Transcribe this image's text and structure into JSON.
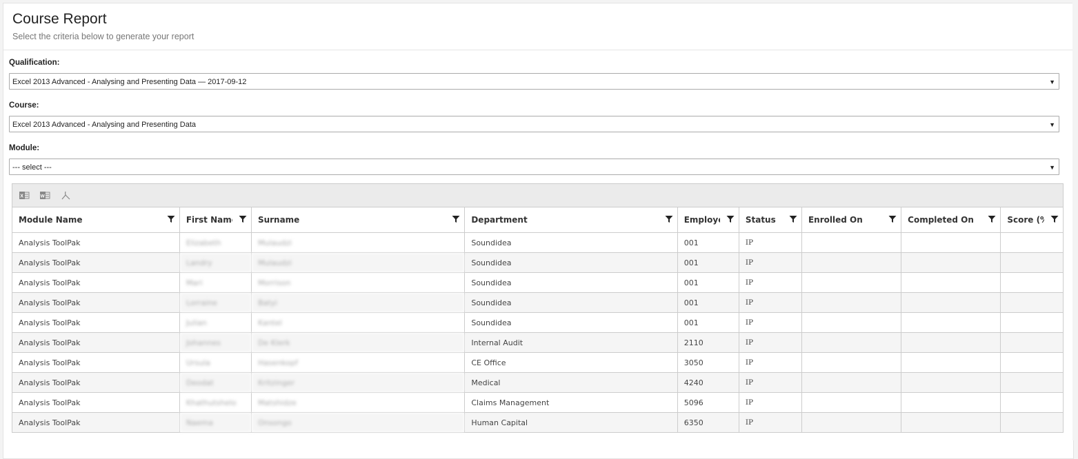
{
  "header": {
    "title": "Course Report",
    "subtitle": "Select the criteria below to generate your report"
  },
  "form": {
    "qualification": {
      "label": "Qualification:",
      "value": "Excel 2013 Advanced - Analysing and Presenting Data — 2017-09-12"
    },
    "course": {
      "label": "Course:",
      "value": "Excel 2013 Advanced - Analysing and Presenting Data"
    },
    "module": {
      "label": "Module:",
      "value": "--- select ---"
    },
    "caret_glyph": "▼"
  },
  "toolbar": {
    "icons": [
      "excel-export-icon",
      "word-export-icon",
      "pdf-export-icon"
    ]
  },
  "table": {
    "columns": [
      {
        "label": "Module Name"
      },
      {
        "label": "First Name"
      },
      {
        "label": "Surname"
      },
      {
        "label": "Department"
      },
      {
        "label": "Employee No"
      },
      {
        "label": "Status"
      },
      {
        "label": "Enrolled On"
      },
      {
        "label": "Completed On"
      },
      {
        "label": "Score (%)"
      }
    ],
    "rows": [
      {
        "module": "Analysis ToolPak",
        "first": "Elizabeth",
        "surname": "Mulaudzi",
        "department": "Soundidea",
        "employee": "001",
        "status": "IP",
        "enrolled": "",
        "completed": "",
        "score": ""
      },
      {
        "module": "Analysis ToolPak",
        "first": "Landry",
        "surname": "Mulaudzi",
        "department": "Soundidea",
        "employee": "001",
        "status": "IP",
        "enrolled": "",
        "completed": "",
        "score": ""
      },
      {
        "module": "Analysis ToolPak",
        "first": "Mari",
        "surname": "Morrison",
        "department": "Soundidea",
        "employee": "001",
        "status": "IP",
        "enrolled": "",
        "completed": "",
        "score": ""
      },
      {
        "module": "Analysis ToolPak",
        "first": "Lorraine",
        "surname": "Batyi",
        "department": "Soundidea",
        "employee": "001",
        "status": "IP",
        "enrolled": "",
        "completed": "",
        "score": ""
      },
      {
        "module": "Analysis ToolPak",
        "first": "Julian",
        "surname": "Kantel",
        "department": "Soundidea",
        "employee": "001",
        "status": "IP",
        "enrolled": "",
        "completed": "",
        "score": ""
      },
      {
        "module": "Analysis ToolPak",
        "first": "Johannes",
        "surname": "De Klerk",
        "department": "Internal Audit",
        "employee": "2110",
        "status": "IP",
        "enrolled": "",
        "completed": "",
        "score": ""
      },
      {
        "module": "Analysis ToolPak",
        "first": "Ursula",
        "surname": "Hasenkopf",
        "department": "CE Office",
        "employee": "3050",
        "status": "IP",
        "enrolled": "",
        "completed": "",
        "score": ""
      },
      {
        "module": "Analysis ToolPak",
        "first": "Deodat",
        "surname": "Kritzinger",
        "department": "Medical",
        "employee": "4240",
        "status": "IP",
        "enrolled": "",
        "completed": "",
        "score": ""
      },
      {
        "module": "Analysis ToolPak",
        "first": "Khathutshelo",
        "surname": "Matshidze",
        "department": "Claims Management",
        "employee": "5096",
        "status": "IP",
        "enrolled": "",
        "completed": "",
        "score": ""
      },
      {
        "module": "Analysis ToolPak",
        "first": "Naema",
        "surname": "Onsongo",
        "department": "Human Capital",
        "employee": "6350",
        "status": "IP",
        "enrolled": "",
        "completed": "",
        "score": ""
      }
    ]
  }
}
